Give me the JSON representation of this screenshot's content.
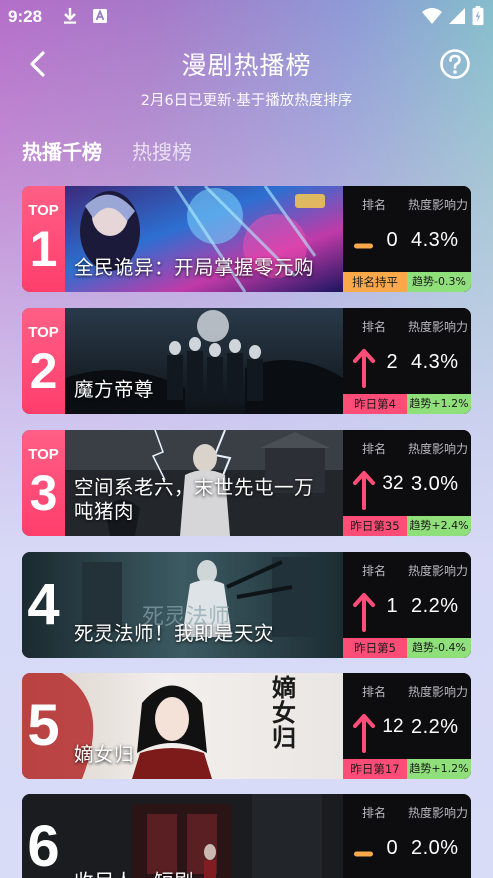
{
  "status_bar": {
    "time": "9:28"
  },
  "header": {
    "title": "漫剧热播榜",
    "subtitle": "2月6日已更新·基于播放热度排序"
  },
  "tabs": [
    {
      "label": "热播千榜",
      "active": true
    },
    {
      "label": "热搜榜",
      "active": false
    }
  ],
  "stat_headers": {
    "rank": "排名",
    "heat": "热度影响力"
  },
  "colors": {
    "accent_pink": "#ff4d78",
    "up_arrow": "#ff4d78",
    "flat_dash": "#f9a94a",
    "trend_green": "#8fe07a"
  },
  "shows": [
    {
      "rank": "1",
      "top_label": "TOP",
      "title": "全民诡异：开局掌握零元购",
      "trend": "flat",
      "rank_change": "0",
      "heat": "4.3%",
      "badge_left": "排名持平",
      "badge_left_color": "yellow",
      "badge_right": "趋势-0.3%"
    },
    {
      "rank": "2",
      "top_label": "TOP",
      "title": "魔方帝尊",
      "trend": "up",
      "rank_change": "2",
      "heat": "4.3%",
      "badge_left": "昨日第4",
      "badge_left_color": "red",
      "badge_right": "趋势+1.2%"
    },
    {
      "rank": "3",
      "top_label": "TOP",
      "title": "空间系老六，末世先屯一万吨猪肉",
      "trend": "up",
      "rank_change": "32",
      "heat": "3.0%",
      "badge_left": "昨日第35",
      "badge_left_color": "red",
      "badge_right": "趋势+2.4%"
    },
    {
      "rank": "4",
      "top_label": "",
      "title": "死灵法师！我即是天灾",
      "trend": "up",
      "rank_change": "1",
      "heat": "2.2%",
      "badge_left": "昨日第5",
      "badge_left_color": "red",
      "badge_right": "趋势-0.4%"
    },
    {
      "rank": "5",
      "top_label": "",
      "title": "嫡女归",
      "trend": "up",
      "rank_change": "12",
      "heat": "2.2%",
      "badge_left": "昨日第17",
      "badge_left_color": "red",
      "badge_right": "趋势+1.2%"
    },
    {
      "rank": "6",
      "top_label": "",
      "title": "收尸人，短剧",
      "trend": "flat",
      "rank_change": "0",
      "heat": "2.0%",
      "badge_left": "",
      "badge_left_color": "",
      "badge_right": ""
    }
  ],
  "poster_art": {
    "card5_calligraphy": "嫡女归"
  }
}
